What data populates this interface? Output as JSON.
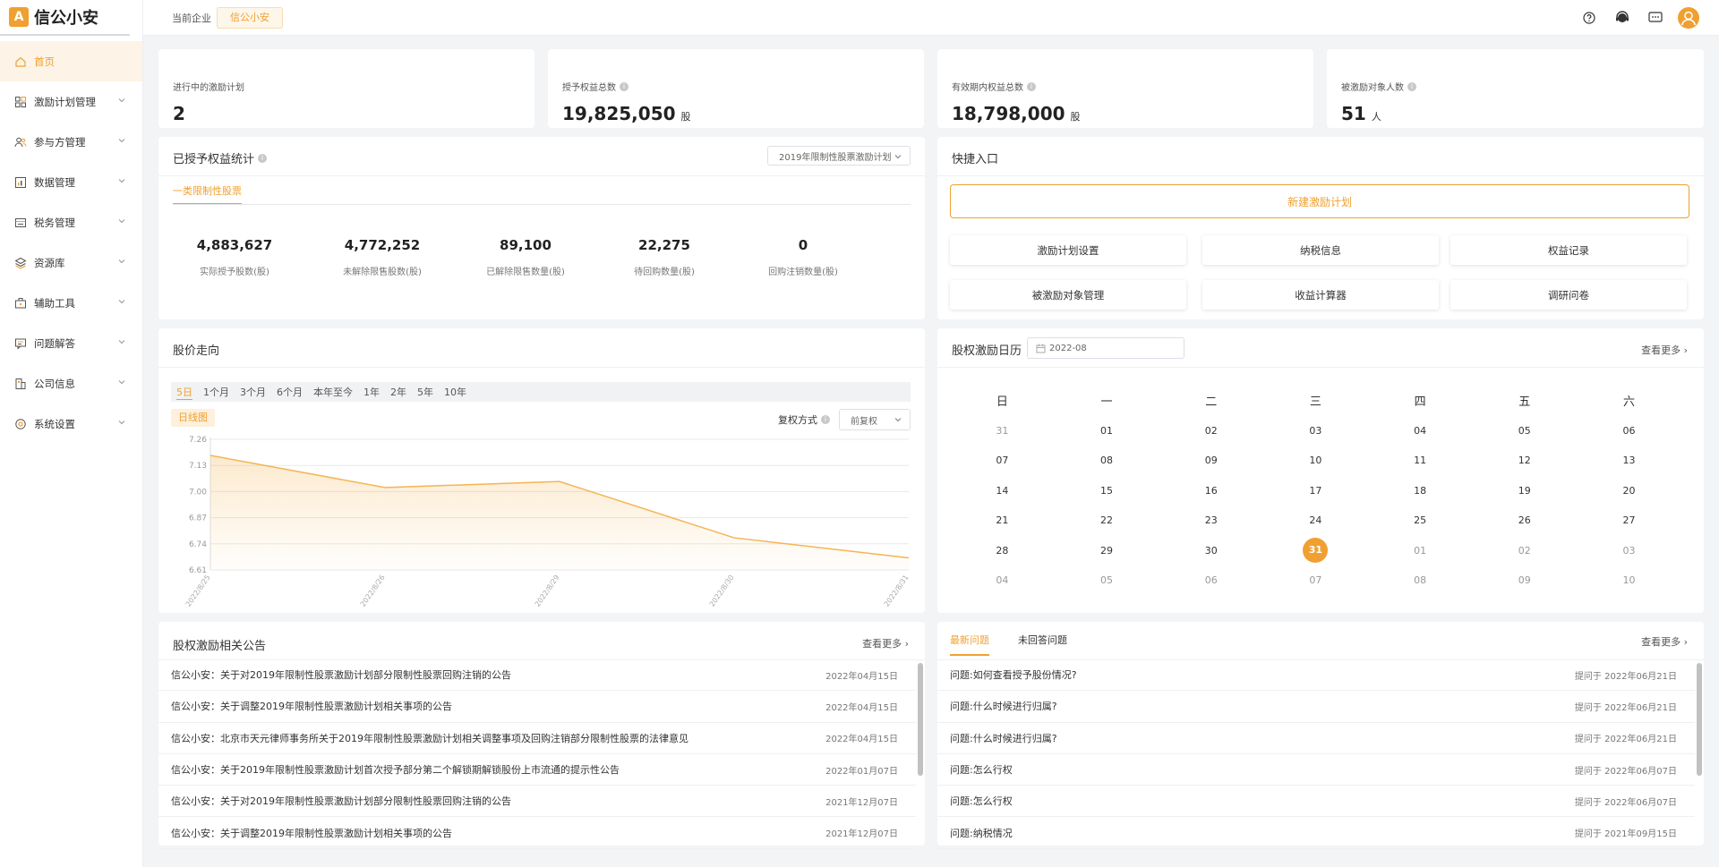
{
  "app": {
    "name": "信公小安",
    "logo_letter": "A"
  },
  "header": {
    "company_label": "当前企业",
    "company_name": "信公小安"
  },
  "sidebar": {
    "items": [
      {
        "label": "首页",
        "icon": "home-icon",
        "active": true
      },
      {
        "label": "激励计划管理",
        "icon": "grid-icon"
      },
      {
        "label": "参与方管理",
        "icon": "users-icon"
      },
      {
        "label": "数据管理",
        "icon": "chart-icon"
      },
      {
        "label": "税务管理",
        "icon": "tax-icon"
      },
      {
        "label": "资源库",
        "icon": "layers-icon"
      },
      {
        "label": "辅助工具",
        "icon": "toolbox-icon"
      },
      {
        "label": "问题解答",
        "icon": "chat-icon"
      },
      {
        "label": "公司信息",
        "icon": "building-icon"
      },
      {
        "label": "系统设置",
        "icon": "settings-icon"
      }
    ]
  },
  "stats": [
    {
      "label": "进行中的激励计划",
      "value": "2",
      "unit": "",
      "info": false
    },
    {
      "label": "授予权益总数",
      "value": "19,825,050",
      "unit": "股",
      "info": true
    },
    {
      "label": "有效期内权益总数",
      "value": "18,798,000",
      "unit": "股",
      "info": true
    },
    {
      "label": "被激励对象人数",
      "value": "51",
      "unit": "人",
      "info": true
    }
  ],
  "granted": {
    "title": "已授予权益统计",
    "plan_select": "2019年限制性股票激励计划",
    "tab": "一类限制性股票",
    "metrics": [
      {
        "value": "4,883,627",
        "label": "实际授予股数(股)"
      },
      {
        "value": "4,772,252",
        "label": "未解除限售股数(股)"
      },
      {
        "value": "89,100",
        "label": "已解除限售数量(股)"
      },
      {
        "value": "22,275",
        "label": "待回购数量(股)"
      },
      {
        "value": "0",
        "label": "回购注销数量(股)"
      }
    ]
  },
  "quick": {
    "title": "快捷入口",
    "main_button": "新建激励计划",
    "buttons": [
      "激励计划设置",
      "纳税信息",
      "权益记录",
      "被激励对象管理",
      "收益计算器",
      "调研问卷"
    ]
  },
  "stock": {
    "title": "股价走向",
    "ranges": [
      "5日",
      "1个月",
      "3个月",
      "6个月",
      "本年至今",
      "1年",
      "2年",
      "5年",
      "10年"
    ],
    "active_range": "5日",
    "chart_tab": "日线图",
    "adjust_label": "复权方式",
    "adjust_value": "前复权"
  },
  "chart_data": {
    "type": "area",
    "x": [
      "2022/8/25",
      "2022/8/26",
      "2022/8/29",
      "2022/8/30",
      "2022/8/31"
    ],
    "series": [
      {
        "values": [
          7.18,
          7.02,
          7.05,
          6.77,
          6.67
        ]
      }
    ],
    "yticks": [
      "7.26",
      "7.13",
      "7.00",
      "6.87",
      "6.74",
      "6.61"
    ],
    "ylim": [
      6.61,
      7.26
    ],
    "grid": true,
    "color": "#f5b453"
  },
  "calendar": {
    "title": "股权激励日历",
    "month": "2022-08",
    "more": "查看更多",
    "weekdays": [
      "日",
      "一",
      "二",
      "三",
      "四",
      "五",
      "六"
    ],
    "weeks": [
      [
        "31",
        "01",
        "02",
        "03",
        "04",
        "05",
        "06"
      ],
      [
        "07",
        "08",
        "09",
        "10",
        "11",
        "12",
        "13"
      ],
      [
        "14",
        "15",
        "16",
        "17",
        "18",
        "19",
        "20"
      ],
      [
        "21",
        "22",
        "23",
        "24",
        "25",
        "26",
        "27"
      ],
      [
        "28",
        "29",
        "30",
        "31",
        "01",
        "02",
        "03"
      ],
      [
        "04",
        "05",
        "06",
        "07",
        "08",
        "09",
        "10"
      ]
    ],
    "today": "31"
  },
  "announcements": {
    "title": "股权激励相关公告",
    "more": "查看更多",
    "items": [
      {
        "title": "信公小安：关于对2019年限制性股票激励计划部分限制性股票回购注销的公告",
        "date": "2022年04月15日"
      },
      {
        "title": "信公小安：关于调整2019年限制性股票激励计划相关事项的公告",
        "date": "2022年04月15日"
      },
      {
        "title": "信公小安：北京市天元律师事务所关于2019年限制性股票激励计划相关调整事项及回购注销部分限制性股票的法律意见",
        "date": "2022年04月15日"
      },
      {
        "title": "信公小安：关于2019年限制性股票激励计划首次授予部分第二个解锁期解锁股份上市流通的提示性公告",
        "date": "2022年01月07日"
      },
      {
        "title": "信公小安：关于对2019年限制性股票激励计划部分限制性股票回购注销的公告",
        "date": "2021年12月07日"
      },
      {
        "title": "信公小安：关于调整2019年限制性股票激励计划相关事项的公告",
        "date": "2021年12月07日"
      }
    ]
  },
  "questions": {
    "tabs": [
      "最新问题",
      "未回答问题"
    ],
    "more": "查看更多",
    "items": [
      {
        "title": "问题:如何查看授予股份情况?",
        "date": "提问于 2022年06月21日"
      },
      {
        "title": "问题:什么时候进行归属?",
        "date": "提问于 2022年06月21日"
      },
      {
        "title": "问题:什么时候进行归属?",
        "date": "提问于 2022年06月21日"
      },
      {
        "title": "问题:怎么行权",
        "date": "提问于 2022年06月07日"
      },
      {
        "title": "问题:怎么行权",
        "date": "提问于 2022年06月07日"
      },
      {
        "title": "问题:纳税情况",
        "date": "提问于 2021年09月15日"
      }
    ]
  }
}
